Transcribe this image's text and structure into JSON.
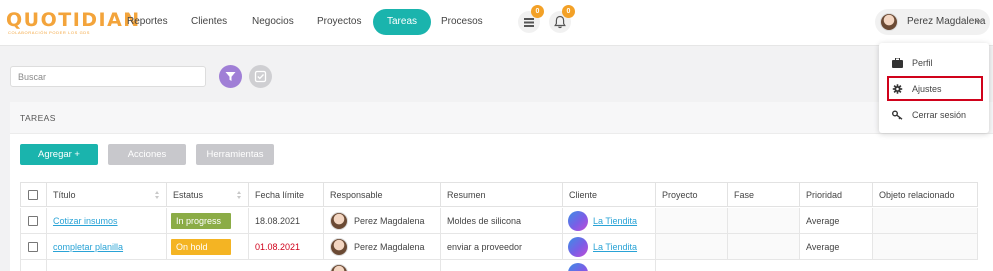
{
  "brand": {
    "name": "QUOTIDIAN",
    "tagline": "COLABORACIÓN PODER LOS GDS"
  },
  "nav": [
    {
      "label": "Reportes",
      "active": false
    },
    {
      "label": "Clientes",
      "active": false
    },
    {
      "label": "Negocios",
      "active": false
    },
    {
      "label": "Proyectos",
      "active": false
    },
    {
      "label": "Tareas",
      "active": true
    },
    {
      "label": "Procesos",
      "active": false
    }
  ],
  "notifications": {
    "list_count": "0",
    "bell_count": "0"
  },
  "user": {
    "name": "Perez Magdalena"
  },
  "user_menu": [
    {
      "label": "Perfil",
      "icon": "briefcase-icon"
    },
    {
      "label": "Ajustes",
      "icon": "gear-icon",
      "highlighted": true
    },
    {
      "label": "Cerrar sesión",
      "icon": "key-icon"
    }
  ],
  "search": {
    "placeholder": "Buscar",
    "value": ""
  },
  "panel": {
    "title": "TAREAS",
    "buttons": {
      "add": "Agregar +",
      "actions": "Acciones",
      "tools": "Herramientas"
    }
  },
  "table": {
    "headers": [
      "Título",
      "Estatus",
      "Fecha límite",
      "Responsable",
      "Resumen",
      "Cliente",
      "Proyecto",
      "Fase",
      "Prioridad",
      "Objeto relacionado"
    ],
    "rows": [
      {
        "title": "Cotizar insumos",
        "status": "In progress",
        "status_color": "#8bac46",
        "due": "18.08.2021",
        "due_overdue": false,
        "owner": "Perez Magdalena",
        "summary": "Moldes de silicona",
        "client": "La Tiendita",
        "project": "",
        "phase": "",
        "priority": "Average",
        "related": ""
      },
      {
        "title": "completar planilla",
        "status": "On hold",
        "status_color": "#f4b423",
        "due": "01.08.2021",
        "due_overdue": true,
        "owner": "Perez Magdalena",
        "summary": "enviar a proveedor",
        "client": "La Tiendita",
        "project": "",
        "phase": "",
        "priority": "Average",
        "related": ""
      }
    ]
  },
  "colors": {
    "accent": "#1ab4ad",
    "filter": "#a07fd6",
    "overdue": "#d0021b",
    "link": "#29a3d6",
    "highlight": "#d0021b"
  }
}
